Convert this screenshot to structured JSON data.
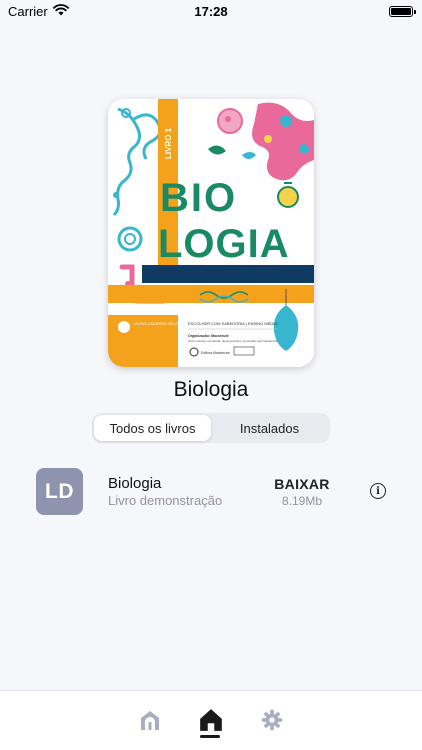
{
  "status_bar": {
    "carrier": "Carrier",
    "time": "17:28"
  },
  "cover": {
    "series_label": "LIVRO 1",
    "title_line1": "BIO",
    "title_line2": "LOGIA",
    "footer_box": "LIVRO-CADERNO DE ATIVIDADES DO ALUNO",
    "footer_series": "ESCOLHER COM SABEDORIA | ENSINO MÉDIO",
    "organizer_title": "Organização: Mackenzie",
    "organizer_text": "Obra coletiva concebida, desenvolvida e produzida pelo Mackenzie",
    "publisher": "Editora Mackenzie"
  },
  "book": {
    "title": "Biologia"
  },
  "segmented": {
    "all_label": "Todos os livros",
    "installed_label": "Instalados",
    "selected": "Todos os livros"
  },
  "book_row": {
    "thumb_initials": "LD",
    "title": "Biologia",
    "subtitle": "Livro demonstração",
    "action_label": "BAIXAR",
    "size": "8.19Mb"
  },
  "tab_bar": {
    "tabs": [
      "library-icon",
      "home-icon",
      "gear-icon"
    ],
    "active_tab": "home-icon"
  },
  "colors": {
    "background": "#f6f7fb",
    "thumb": "#8e94ad",
    "cover_orange": "#f4a11b",
    "cover_navy": "#0f3a63",
    "cover_green": "#1a8a63",
    "cover_pink": "#e9699a",
    "cover_cyan": "#39b6cf",
    "inactive_icon": "#a9aec2"
  }
}
